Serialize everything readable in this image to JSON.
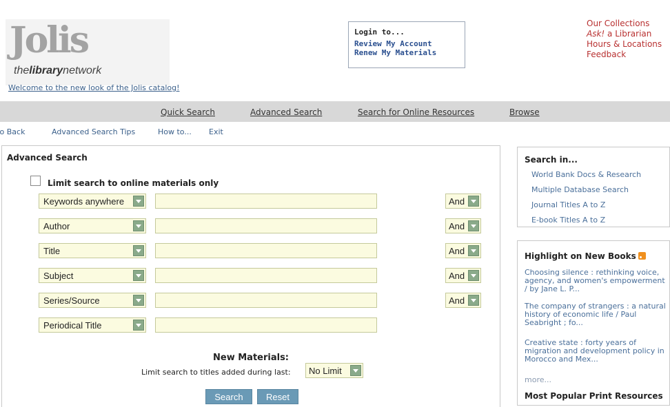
{
  "header": {
    "logo_main": "Jolis",
    "logo_sub_pre": "the",
    "logo_sub_bold": "library",
    "logo_sub_post": "network",
    "welcome_link": "Welcome to the new look of the Jolis catalog!"
  },
  "login": {
    "title": "Login to...",
    "links": [
      "Review My Account",
      "Renew My Materials"
    ]
  },
  "top_links": {
    "collections": "Our Collections",
    "ask_italic": "Ask!",
    "ask_rest": " a Librarian",
    "hours": "Hours & Locations",
    "feedback": "Feedback"
  },
  "nav": {
    "items": [
      "Quick Search",
      "Advanced Search",
      "Search for Online Resources",
      "Browse"
    ]
  },
  "subnav": {
    "items": [
      "Go Back",
      "Advanced Search Tips",
      "How to...",
      "Exit"
    ]
  },
  "advanced": {
    "title": "Advanced Search",
    "limit_online_label": "Limit search to online materials only",
    "limit_online_checked": false,
    "rows": [
      {
        "field": "Keywords anywhere",
        "value": "",
        "bool": "And"
      },
      {
        "field": "Author",
        "value": "",
        "bool": "And"
      },
      {
        "field": "Title",
        "value": "",
        "bool": "And"
      },
      {
        "field": "Subject",
        "value": "",
        "bool": "And"
      },
      {
        "field": "Series/Source",
        "value": "",
        "bool": "And"
      },
      {
        "field": "Periodical Title",
        "value": ""
      }
    ],
    "new_materials_title": "New Materials:",
    "new_materials_label": "Limit search to titles added during last:",
    "new_materials_value": "No Limit",
    "search_button": "Search",
    "reset_button": "Reset"
  },
  "search_in": {
    "heading": "Search in...",
    "links": [
      "World Bank Docs & Research",
      "Multiple Database Search",
      "Journal Titles A to Z",
      "E-book Titles A to Z"
    ]
  },
  "new_books": {
    "heading": "Highlight on New Books",
    "books": [
      "Choosing silence : rethinking voice, agency, and women's empowerment / by Jane L. P...",
      "The company of strangers : a natural history of economic life / Paul Seabright ; fo...",
      "Creative state : forty years of migration and development policy in Morocco and Mex..."
    ],
    "more": "more...",
    "popular_heading": "Most Popular Print Resources"
  },
  "colors": {
    "link_red": "#b83030",
    "link_blue": "#3a5f8a",
    "navbar_bg": "#d8d8d8",
    "input_bg": "#fbfbe0",
    "button_bg": "#6a9ab6",
    "arrow_green": "#8aaa8a"
  },
  "icons": {
    "dropdown": "chevron-down-icon",
    "rss": "rss-icon"
  }
}
